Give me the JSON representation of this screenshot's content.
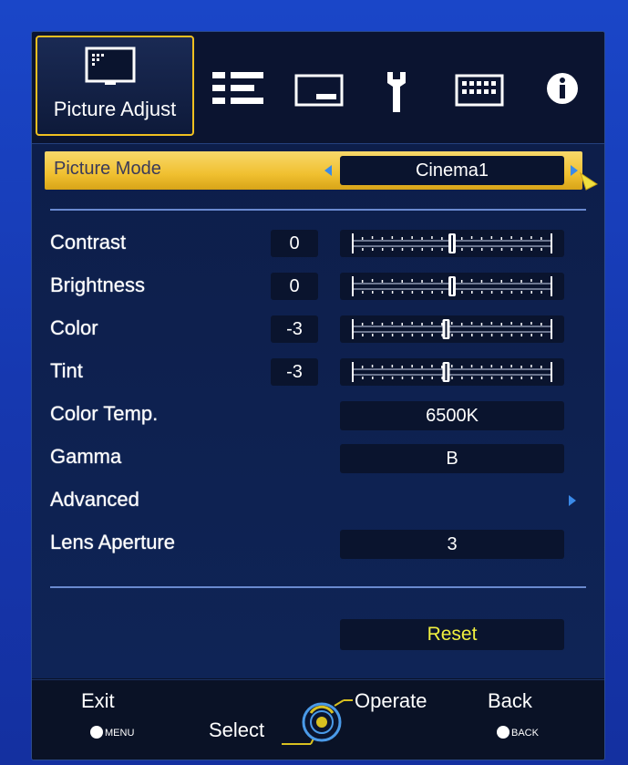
{
  "tabs": {
    "active_label": "Picture Adjust",
    "icons": [
      "picture-icon",
      "input-settings-icon",
      "display-icon",
      "wrench-icon",
      "keyboard-icon",
      "info-icon"
    ]
  },
  "picture_mode": {
    "label": "Picture Mode",
    "value": "Cinema1"
  },
  "rows": [
    {
      "label": "Contrast",
      "value": "0",
      "level": 0
    },
    {
      "label": "Brightness",
      "value": "0",
      "level": 0
    },
    {
      "label": "Color",
      "value": "-3",
      "level": -3
    },
    {
      "label": "Tint",
      "value": "-3",
      "level": -3
    }
  ],
  "color_temp": {
    "label": "Color Temp.",
    "value": "6500K"
  },
  "gamma": {
    "label": "Gamma",
    "value": "B"
  },
  "advanced": {
    "label": "Advanced"
  },
  "lens_aperture": {
    "label": "Lens Aperture",
    "value": "3"
  },
  "reset": {
    "label": "Reset"
  },
  "footer": {
    "exit": "Exit",
    "exit_key": "MENU",
    "select": "Select",
    "operate": "Operate",
    "back": "Back",
    "back_key": "BACK"
  },
  "colors": {
    "highlight": "#f0c030",
    "reset_text": "#f0f040",
    "accent_blue": "#3a8ae8"
  }
}
